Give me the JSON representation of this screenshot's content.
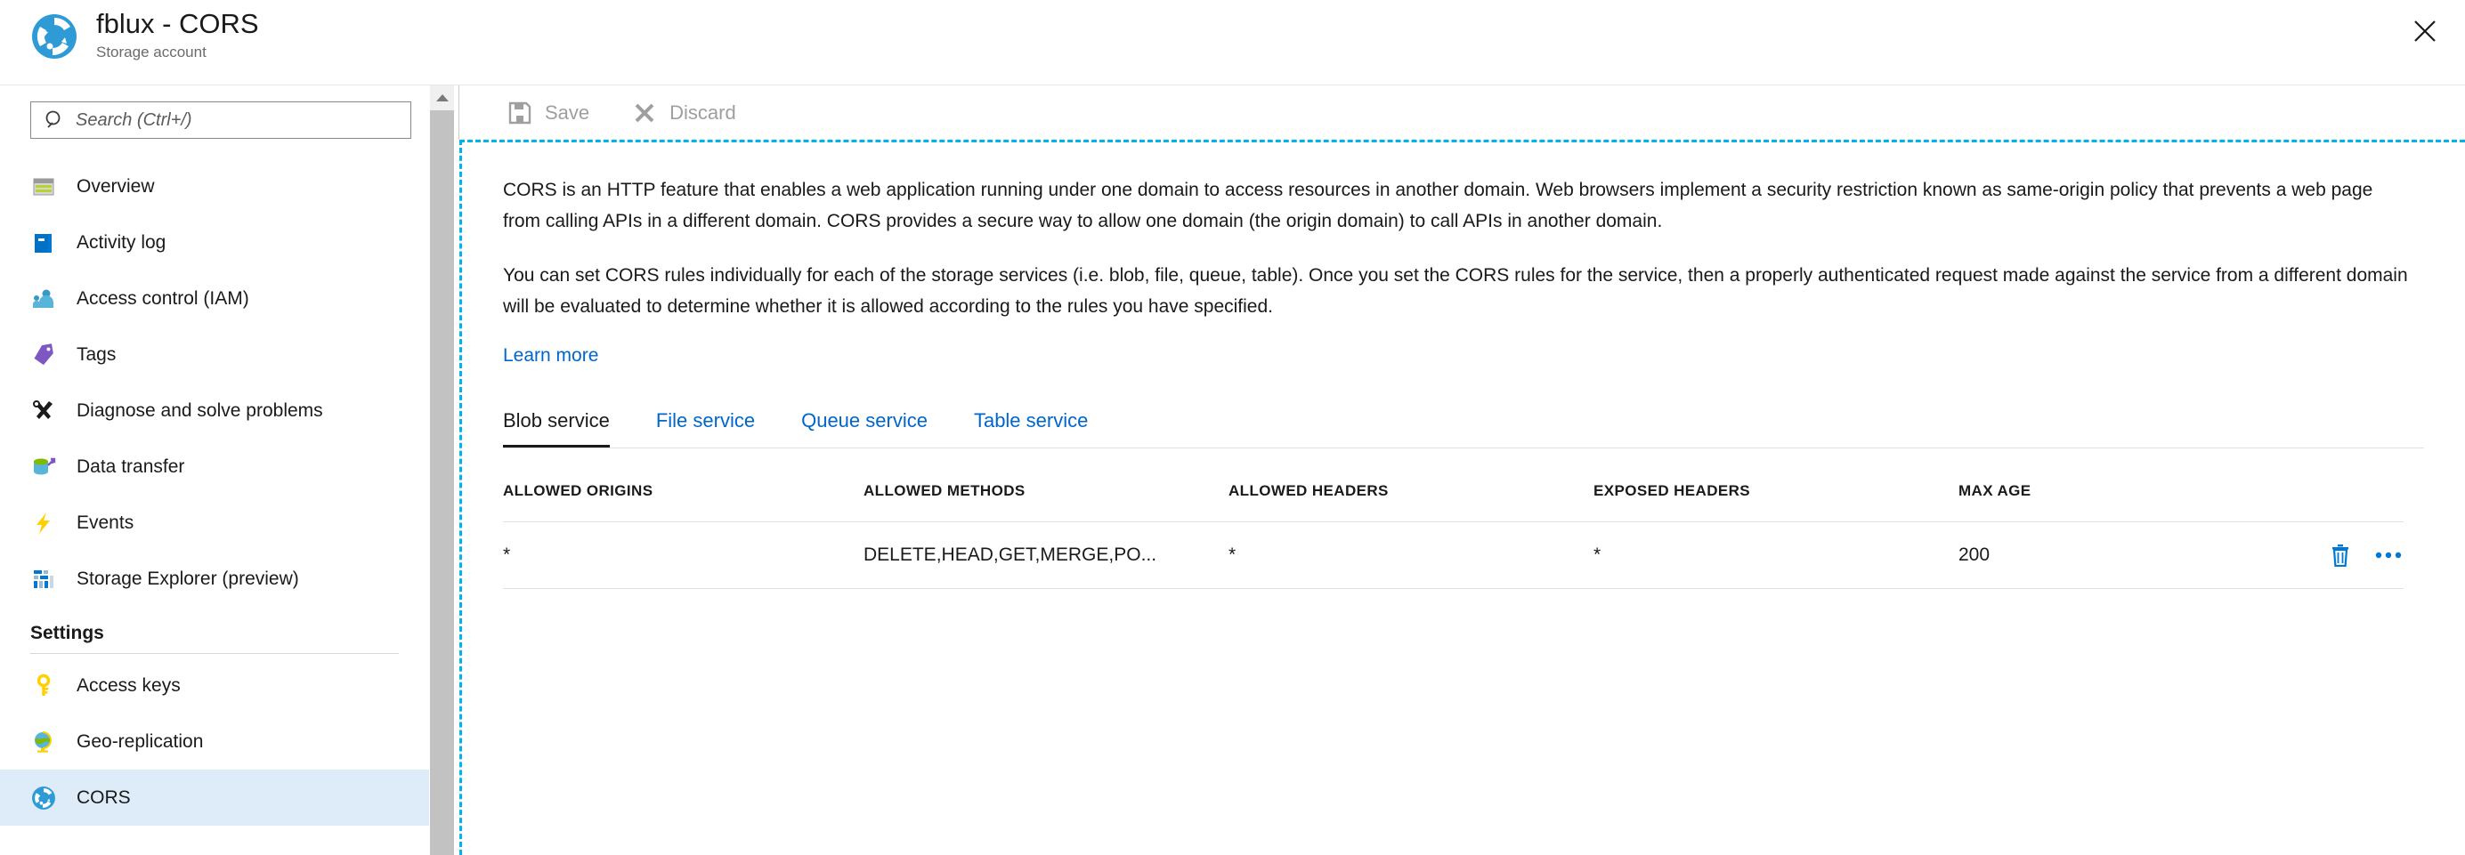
{
  "header": {
    "title": "fblux - CORS",
    "subtitle": "Storage account",
    "resource_icon": "storage-cors-icon",
    "close_icon": "close-icon"
  },
  "sidebar": {
    "search": {
      "placeholder": "Search (Ctrl+/)",
      "value": "",
      "icon": "search-icon"
    },
    "collapse_icon": "chevron-double-left-icon",
    "items": [
      {
        "label": "Overview",
        "icon": "overview-icon",
        "selected": false
      },
      {
        "label": "Activity log",
        "icon": "activity-log-icon",
        "selected": false
      },
      {
        "label": "Access control (IAM)",
        "icon": "access-control-icon",
        "selected": false
      },
      {
        "label": "Tags",
        "icon": "tag-icon",
        "selected": false
      },
      {
        "label": "Diagnose and solve problems",
        "icon": "diagnose-tools-icon",
        "selected": false
      },
      {
        "label": "Data transfer",
        "icon": "data-transfer-icon",
        "selected": false
      },
      {
        "label": "Events",
        "icon": "events-lightning-icon",
        "selected": false
      },
      {
        "label": "Storage Explorer (preview)",
        "icon": "storage-explorer-icon",
        "selected": false
      }
    ],
    "section_title": "Settings",
    "settings_items": [
      {
        "label": "Access keys",
        "icon": "key-icon",
        "selected": false
      },
      {
        "label": "Geo-replication",
        "icon": "globe-icon",
        "selected": false
      },
      {
        "label": "CORS",
        "icon": "storage-cors-icon",
        "selected": true
      }
    ],
    "scrollbar_up_icon": "caret-up-icon"
  },
  "toolbar": {
    "save_label": "Save",
    "save_icon": "save-disk-icon",
    "discard_label": "Discard",
    "discard_icon": "discard-x-icon"
  },
  "main": {
    "paragraph_1": "CORS is an HTTP feature that enables a web application running under one domain to access resources in another domain. Web browsers implement a security restriction known as same-origin policy that prevents a web page from calling APIs in a different domain. CORS provides a secure way to allow one domain (the origin domain) to call APIs in another domain.",
    "paragraph_2": "You can set CORS rules individually for each of the storage services (i.e. blob, file, queue, table). Once you set the CORS rules for the service, then a properly authenticated request made against the service from a different domain will be evaluated to determine whether it is allowed according to the rules you have specified.",
    "learn_more_label": "Learn more",
    "tabs": [
      {
        "label": "Blob service",
        "active": true
      },
      {
        "label": "File service",
        "active": false
      },
      {
        "label": "Queue service",
        "active": false
      },
      {
        "label": "Table service",
        "active": false
      }
    ],
    "table": {
      "columns": [
        "ALLOWED ORIGINS",
        "ALLOWED METHODS",
        "ALLOWED HEADERS",
        "EXPOSED HEADERS",
        "MAX AGE"
      ],
      "rows": [
        {
          "allowed_origins": "*",
          "allowed_methods": "DELETE,HEAD,GET,MERGE,PO...",
          "allowed_headers": "*",
          "exposed_headers": "*",
          "max_age": "200",
          "delete_icon": "trash-icon",
          "more_icon": "ellipsis-icon"
        }
      ]
    }
  },
  "colors": {
    "accent_blue": "#0066cc",
    "link_blue": "#0078d4",
    "selected_row": "#deecf9",
    "panel_outline": "#00b3f0",
    "disabled_text": "#a19f9d"
  }
}
